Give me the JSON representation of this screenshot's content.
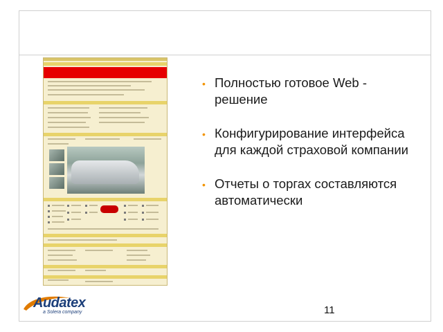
{
  "slide": {
    "bullets": [
      "Полностью готовое Web - решение",
      "Конфигурирование интерфейса для каждой страховой компании",
      "Отчеты о торгах составляются автоматически"
    ],
    "page_number": "11"
  },
  "logo": {
    "name": "Audatex",
    "tagline": "a Solera company"
  },
  "colors": {
    "bullet": "#f29400",
    "logo_blue": "#1c3f7a",
    "logo_swoosh": "#e07b00",
    "highlight_red": "#e60000"
  }
}
